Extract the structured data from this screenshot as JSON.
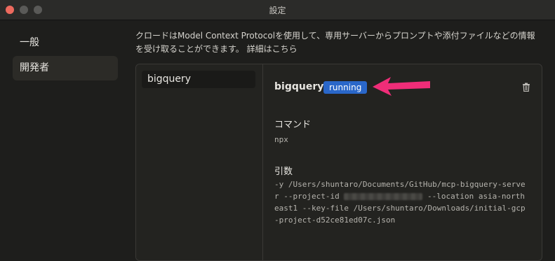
{
  "window": {
    "title": "設定"
  },
  "sidebar": {
    "items": [
      {
        "label": "一般"
      },
      {
        "label": "開発者"
      }
    ]
  },
  "description": {
    "text": "クロードはModel Context Protocolを使用して、専用サーバーからプロンプトや添付ファイルなどの情報を受け取ることができます。",
    "link": "詳細はこちら"
  },
  "servers": [
    {
      "name": "bigquery"
    }
  ],
  "detail": {
    "name": "bigquery",
    "status": "running",
    "command_label": "コマンド",
    "command": "npx",
    "args_label": "引数",
    "args_before": "-y /Users/shuntaro/Documents/GitHub/mcp-bigquery-server --project-id",
    "args_after": "--location asia-northeast1 --key-file /Users/shuntaro/Downloads/initial-gcp-project-d52ce81ed07c.json"
  },
  "colors": {
    "accent": "#2a67c9",
    "arrow": "#ef2d78",
    "close": "#ed6a5e"
  }
}
